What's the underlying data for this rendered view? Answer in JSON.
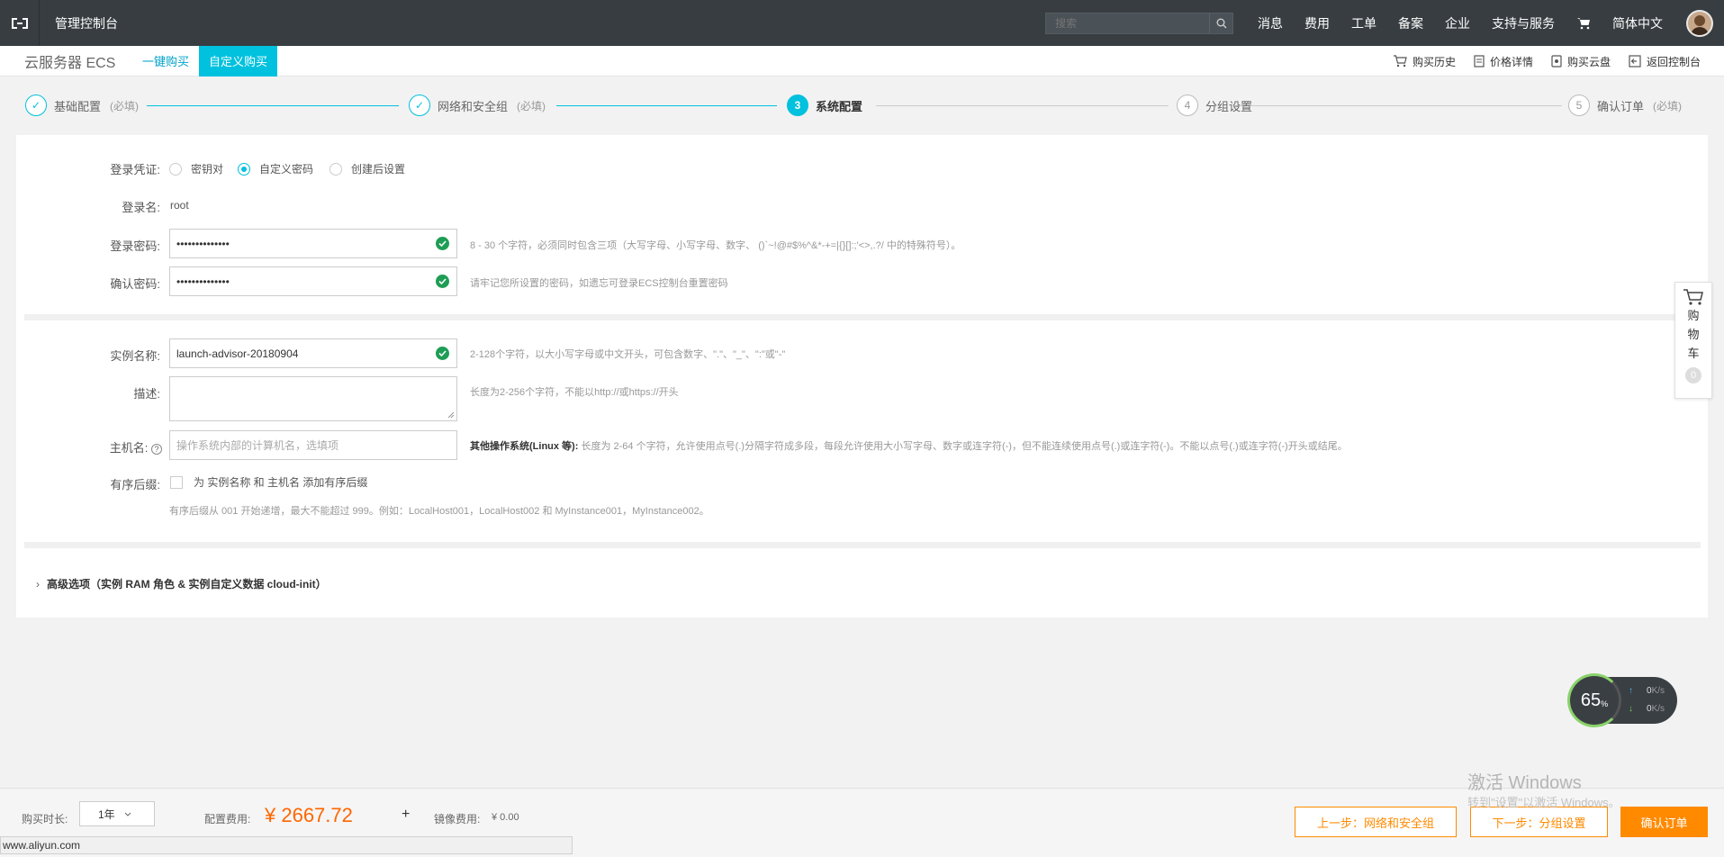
{
  "topbar": {
    "console_label": "管理控制台",
    "search_placeholder": "搜索",
    "nav": [
      "消息",
      "费用",
      "工单",
      "备案",
      "企业",
      "支持与服务"
    ],
    "language": "简体中文"
  },
  "subheader": {
    "product": "云服务器 ECS",
    "tabs": [
      "一键购买",
      "自定义购买"
    ],
    "links": [
      "购买历史",
      "价格详情",
      "购买云盘",
      "返回控制台"
    ]
  },
  "steps": [
    {
      "num": "✓",
      "name": "基础配置",
      "req": "(必填)"
    },
    {
      "num": "✓",
      "name": "网络和安全组",
      "req": "(必填)"
    },
    {
      "num": "3",
      "name": "系统配置",
      "req": ""
    },
    {
      "num": "4",
      "name": "分组设置",
      "req": ""
    },
    {
      "num": "5",
      "name": "确认订单",
      "req": "(必填)"
    }
  ],
  "login": {
    "credential_label": "登录凭证:",
    "options": [
      "密钥对",
      "自定义密码",
      "创建后设置"
    ],
    "username_label": "登录名:",
    "username": "root",
    "password_label": "登录密码:",
    "password_value": "••••••••••••••",
    "password_hint": "8 - 30 个字符，必须同时包含三项（大写字母、小写字母、数字、 ()`~!@#$%^&*-+=|{}[]:;'<>,.?/ 中的特殊符号）。",
    "confirm_label": "确认密码:",
    "confirm_value": "••••••••••••••",
    "confirm_hint": "请牢记您所设置的密码，如遗忘可登录ECS控制台重置密码"
  },
  "instance": {
    "name_label": "实例名称:",
    "name_value": "launch-advisor-20180904",
    "name_hint": "2-128个字符，以大小写字母或中文开头，可包含数字、\".\"、\"_\"、\":\"或\"-\"",
    "desc_label": "描述:",
    "desc_hint": "长度为2-256个字符，不能以http://或https://开头",
    "host_label": "主机名:",
    "host_placeholder": "操作系统内部的计算机名，选填项",
    "host_hint_bold": "其他操作系统(Linux 等):",
    "host_hint": "长度为 2-64 个字符，允许使用点号(.)分隔字符成多段，每段允许使用大小写字母、数字或连字符(-)，但不能连续使用点号(.)或连字符(-)。不能以点号(.)或连字符(-)开头或结尾。",
    "suffix_label": "有序后缀:",
    "suffix_checkbox": "为 实例名称 和 主机名 添加有序后缀",
    "suffix_hint": "有序后缀从 001 开始递增，最大不能超过 999。例如：LocalHost001，LocalHost002 和 MyInstance001，MyInstance002。"
  },
  "advanced": {
    "label": "高级选项（实例 RAM 角色 & 实例自定义数据 cloud-init）"
  },
  "cart": {
    "chars": [
      "购",
      "物",
      "车"
    ],
    "count": "0"
  },
  "speed": {
    "percent": "65",
    "unit": "%",
    "up": "0",
    "down": "0",
    "rate_unit": "K/s"
  },
  "watermark": {
    "line1": "激活 Windows",
    "line2": "转到\"设置\"以激活 Windows。"
  },
  "footer": {
    "duration_label": "购买时长:",
    "duration_value": "1年",
    "config_fee_label": "配置费用:",
    "config_fee_value": "¥ 2667.72",
    "plus": "+",
    "image_fee_label": "镜像费用:",
    "image_fee_value": "¥ 0.00",
    "prev_button": "上一步：网络和安全组",
    "next_button": "下一步：分组设置",
    "confirm_button": "确认订单"
  },
  "statusbar": "www.aliyun.com",
  "colors": {
    "accent": "#00c1de",
    "orange": "#ff8a00",
    "topbar": "#373d41",
    "success": "#1e9d55"
  }
}
